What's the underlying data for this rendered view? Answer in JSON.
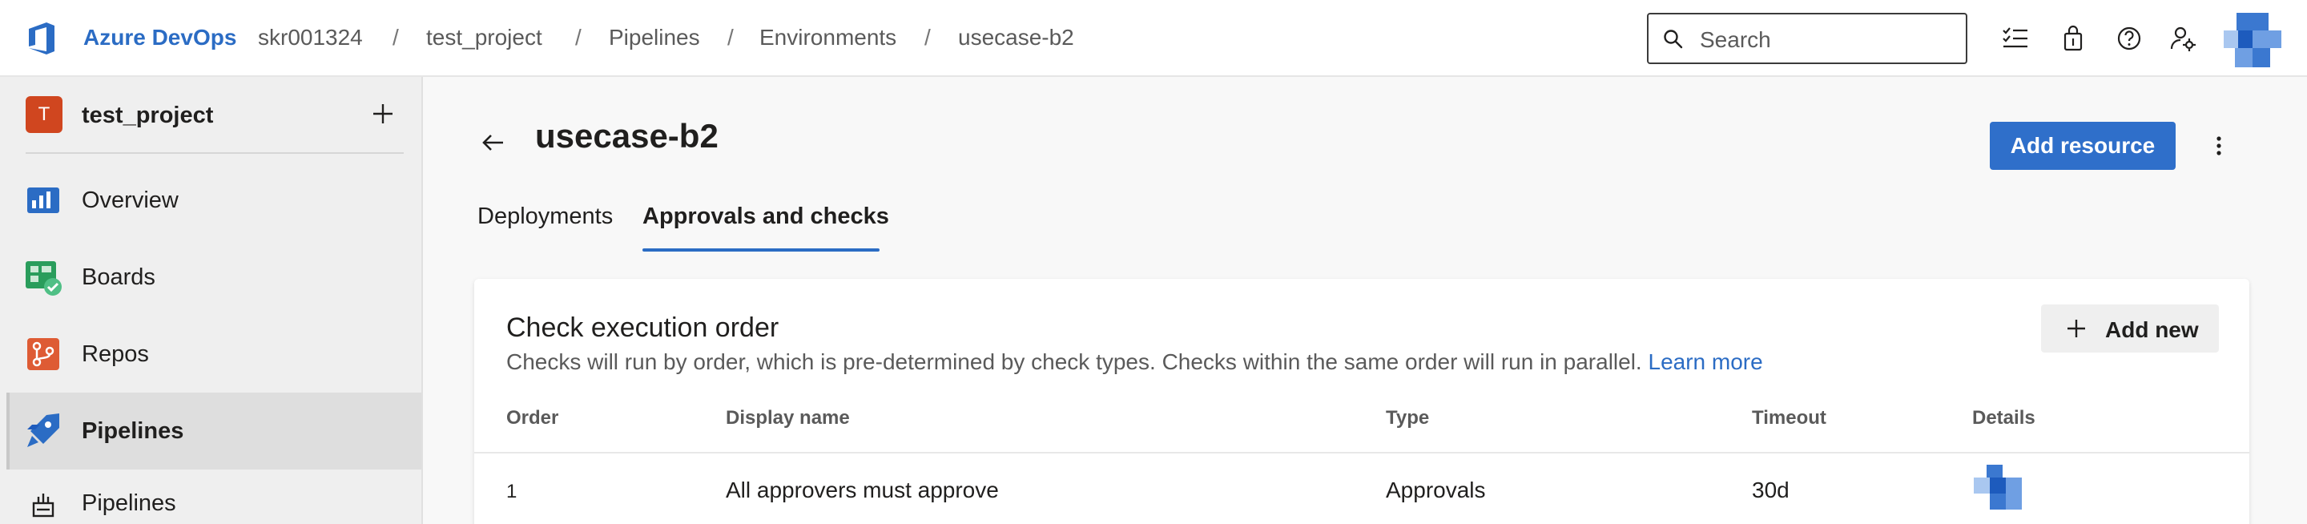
{
  "topbar": {
    "brand": "Azure DevOps",
    "breadcrumbs": [
      "skr001324",
      "test_project",
      "Pipelines",
      "Environments",
      "usecase-b2"
    ],
    "separator": "/",
    "search_placeholder": "Search",
    "icons": [
      "azure-devops-logo-icon",
      "search-icon",
      "work-items-icon",
      "marketplace-icon",
      "help-icon",
      "user-settings-icon",
      "avatar"
    ]
  },
  "sidebar": {
    "project_initial": "T",
    "project_name": "test_project",
    "items": [
      {
        "label": "Overview",
        "icon": "overview-icon"
      },
      {
        "label": "Boards",
        "icon": "boards-icon"
      },
      {
        "label": "Repos",
        "icon": "repos-icon"
      },
      {
        "label": "Pipelines",
        "icon": "pipelines-icon",
        "active": true
      },
      {
        "label": "Pipelines",
        "icon": "pipelines-sub-icon"
      }
    ]
  },
  "main": {
    "title": "usecase-b2",
    "add_resource_label": "Add resource",
    "tabs": [
      {
        "label": "Deployments"
      },
      {
        "label": "Approvals and checks",
        "selected": true
      }
    ]
  },
  "card": {
    "title": "Check execution order",
    "subtitle": "Checks will run by order, which is pre-determined by check types. Checks within the same order will run in parallel.",
    "learn_more": "Learn more",
    "add_new_label": "Add new",
    "columns": [
      "Order",
      "Display name",
      "Type",
      "Timeout",
      "Details"
    ],
    "rows": [
      {
        "order": "1",
        "display_name": "All approvers must approve",
        "type": "Approvals",
        "timeout": "30d"
      }
    ]
  },
  "colors": {
    "brand": "#2b6cc4",
    "primary_button": "#2f6fca",
    "project_icon": "#d0461f"
  }
}
